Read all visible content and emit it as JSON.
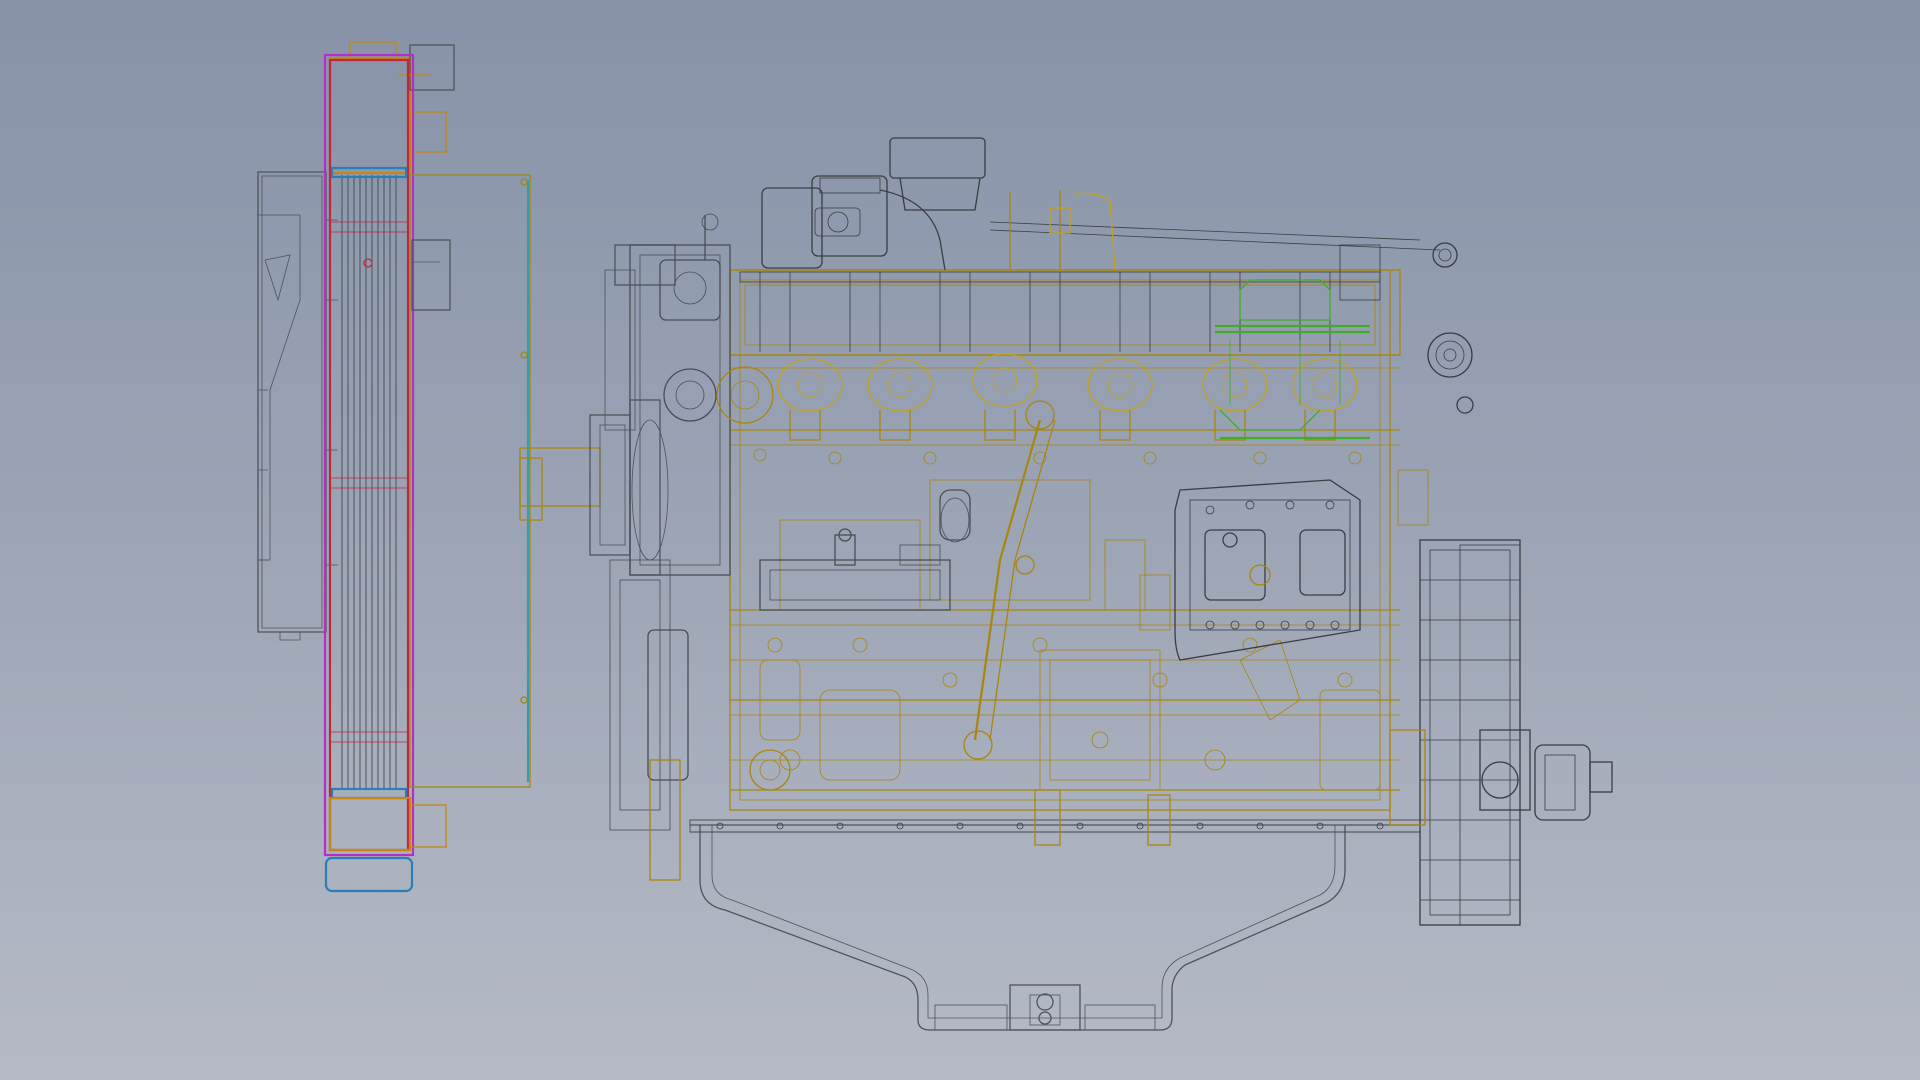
{
  "scene": {
    "view": "side elevation",
    "render_style": "wireframe",
    "background_colors": [
      "#8792a8",
      "#b6bac6"
    ]
  },
  "colors": {
    "engine_block": "#a8860e",
    "engine_block_light": "#c2a21a",
    "structure_gray": "#4a4d55",
    "highlight_green": "#3fae24",
    "radiator_red": "#c3263a",
    "radiator_magenta": "#b42fc8",
    "radiator_orange": "#c38712",
    "radiator_blue": "#2a7fb8",
    "fan_cyan": "#3a9aa8",
    "fan_olive": "#9a8a1a"
  },
  "components": [
    {
      "id": "radiator",
      "label": ""
    },
    {
      "id": "fan-shroud",
      "label": ""
    },
    {
      "id": "engine",
      "label": ""
    },
    {
      "id": "oil-pan",
      "label": ""
    },
    {
      "id": "flywheel-housing",
      "label": ""
    },
    {
      "id": "turbocharger",
      "label": ""
    },
    {
      "id": "intake-manifold",
      "label": ""
    },
    {
      "id": "fuel-pump",
      "label": ""
    },
    {
      "id": "front-pulley",
      "label": ""
    }
  ]
}
